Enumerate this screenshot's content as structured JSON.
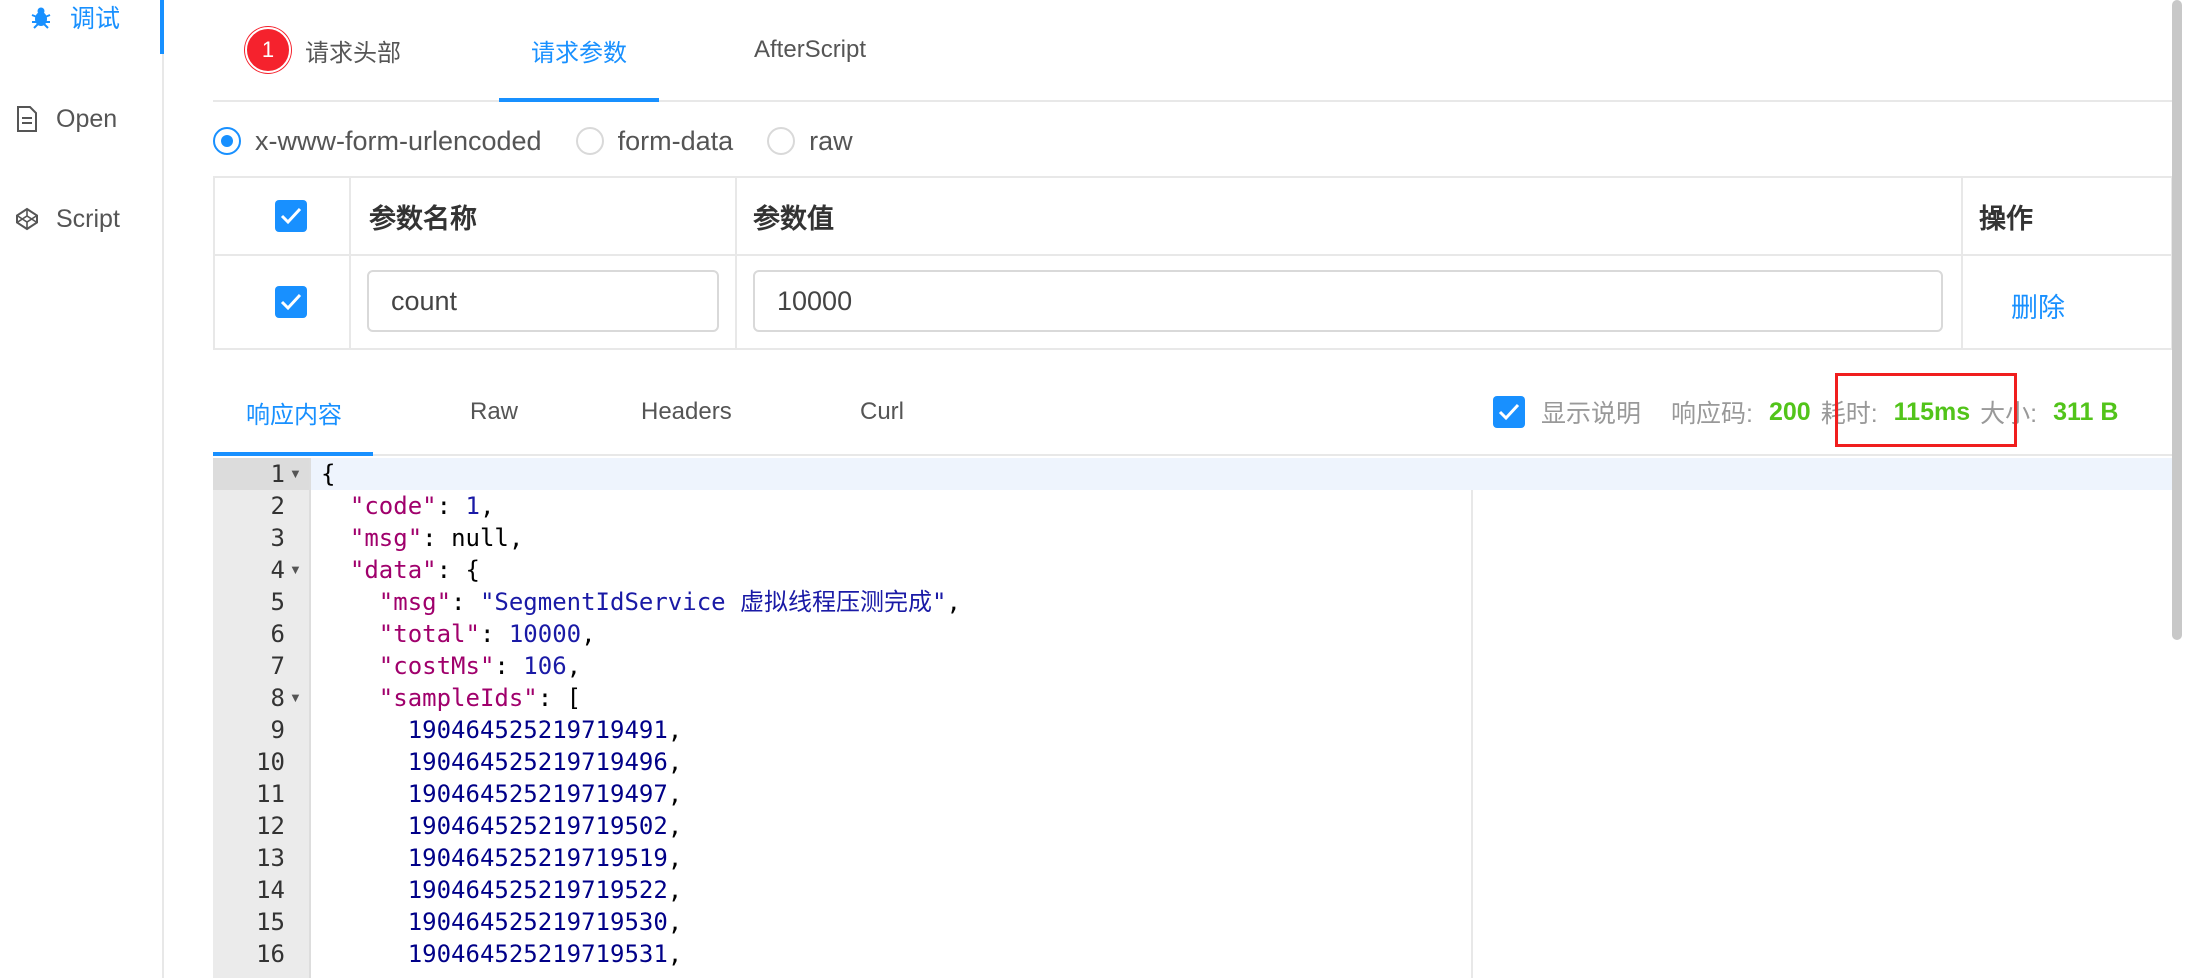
{
  "sidebar": {
    "items": [
      {
        "label": "调试",
        "icon": "bug-icon"
      },
      {
        "label": "Open",
        "icon": "file-icon"
      },
      {
        "label": "Script",
        "icon": "codepen-icon"
      }
    ]
  },
  "request_tabs": {
    "badge": "1",
    "items": [
      "请求头部",
      "请求参数",
      "AfterScript"
    ],
    "active": "请求参数"
  },
  "body_type": {
    "options": [
      "x-www-form-urlencoded",
      "form-data",
      "raw"
    ],
    "selected": "x-www-form-urlencoded"
  },
  "params_table": {
    "headers": [
      "参数名称",
      "参数值",
      "操作"
    ],
    "rows": [
      {
        "name": "count",
        "value": "10000",
        "action": "删除",
        "checked": true
      }
    ]
  },
  "response_tabs": {
    "items": [
      "响应内容",
      "Raw",
      "Headers",
      "Curl"
    ],
    "active": "响应内容"
  },
  "response_meta": {
    "show_desc_label": "显示说明",
    "code_label": "响应码:",
    "code_value": "200",
    "time_label": "耗时:",
    "time_value": "115ms",
    "size_label": "大小:",
    "size_value": "311 B"
  },
  "editor": {
    "line_numbers": [
      "1",
      "2",
      "3",
      "4",
      "5",
      "6",
      "7",
      "8",
      "9",
      "10",
      "11",
      "12",
      "13",
      "14",
      "15",
      "16"
    ],
    "keys": {
      "code": "\"code\"",
      "msg": "\"msg\"",
      "data": "\"data\"",
      "data_msg": "\"msg\"",
      "total": "\"total\"",
      "costMs": "\"costMs\"",
      "sampleIds": "\"sampleIds\""
    },
    "values": {
      "code": "1",
      "msg": "null",
      "data_msg": "\"SegmentIdService 虚拟线程压测完成\"",
      "total": "10000",
      "costMs": "106"
    },
    "sample_ids": [
      "190464525219719491",
      "190464525219719496",
      "190464525219719497",
      "190464525219719502",
      "190464525219719519",
      "190464525219719522",
      "190464525219719530",
      "190464525219719531"
    ]
  },
  "colors": {
    "accent": "#1890ff",
    "success": "#52c41a",
    "badge": "#f5222d",
    "highlight": "#f01e1e"
  }
}
